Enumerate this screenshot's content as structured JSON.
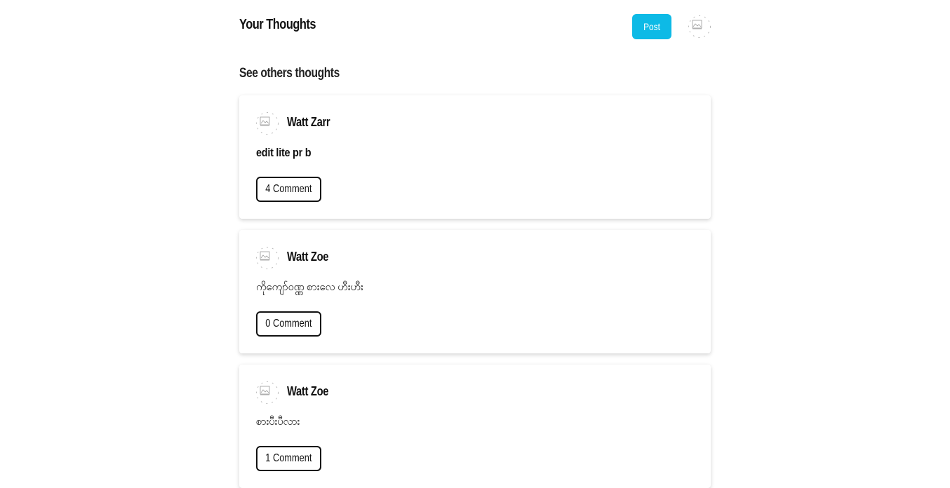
{
  "header": {
    "title": "Your Thoughts",
    "post_label": "Post",
    "accent_color": "#0dbae6"
  },
  "feed": {
    "section_title": "See others thoughts",
    "posts": [
      {
        "author": "Watt Zarr",
        "text": "edit lite pr b",
        "comment_label": "4 Comment"
      },
      {
        "author": "Watt Zoe",
        "text": "ကိုကျော်ဝဏ္ဏ စားလေ ဟီးဟီး",
        "comment_label": "0 Comment"
      },
      {
        "author": "Watt Zoe",
        "text": "စားပီးပီလား",
        "comment_label": "1 Comment"
      }
    ]
  },
  "icons": {
    "avatar": "broken-image-icon"
  }
}
